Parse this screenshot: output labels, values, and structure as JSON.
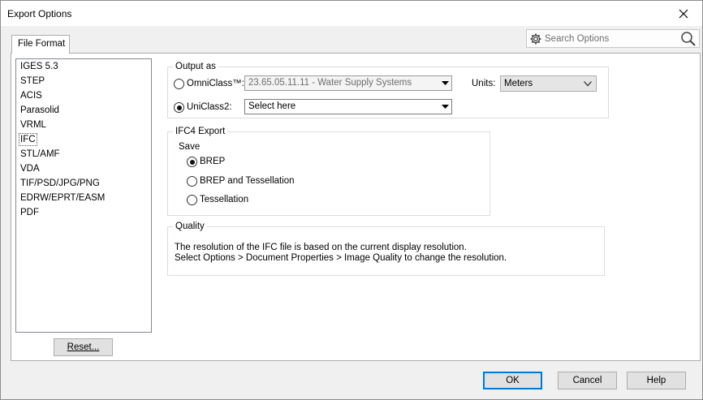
{
  "window": {
    "title": "Export Options"
  },
  "tabs": [
    {
      "label": "File Format"
    }
  ],
  "search": {
    "placeholder": "Search Options"
  },
  "formats": [
    "IGES 5.3",
    "STEP",
    "ACIS",
    "Parasolid",
    "VRML",
    "IFC",
    "STL/AMF",
    "VDA",
    "TIF/PSD/JPG/PNG",
    "EDRW/EPRT/EASM",
    "PDF"
  ],
  "selected_format": "IFC",
  "reset_button": "Reset...",
  "output_as": {
    "legend": "Output as",
    "omniclass_label": "OmniClass™:",
    "omniclass_value": "23.65.05.11.11 - Water Supply Systems",
    "omniclass_selected": false,
    "uniclass_label": "UniClass2:",
    "uniclass_value": "Select here",
    "uniclass_selected": true,
    "units_label": "Units:",
    "units_value": "Meters"
  },
  "ifc4_export": {
    "legend": "IFC4 Export",
    "save_label": "Save",
    "options": [
      "BREP",
      "BREP and Tessellation",
      "Tessellation"
    ],
    "selected": "BREP"
  },
  "quality": {
    "legend": "Quality",
    "line1": "The resolution of the IFC file is based on the current display resolution.",
    "line2": "Select Options > Document Properties > Image Quality to change the resolution."
  },
  "buttons": {
    "ok": "OK",
    "cancel": "Cancel",
    "help": "Help"
  }
}
